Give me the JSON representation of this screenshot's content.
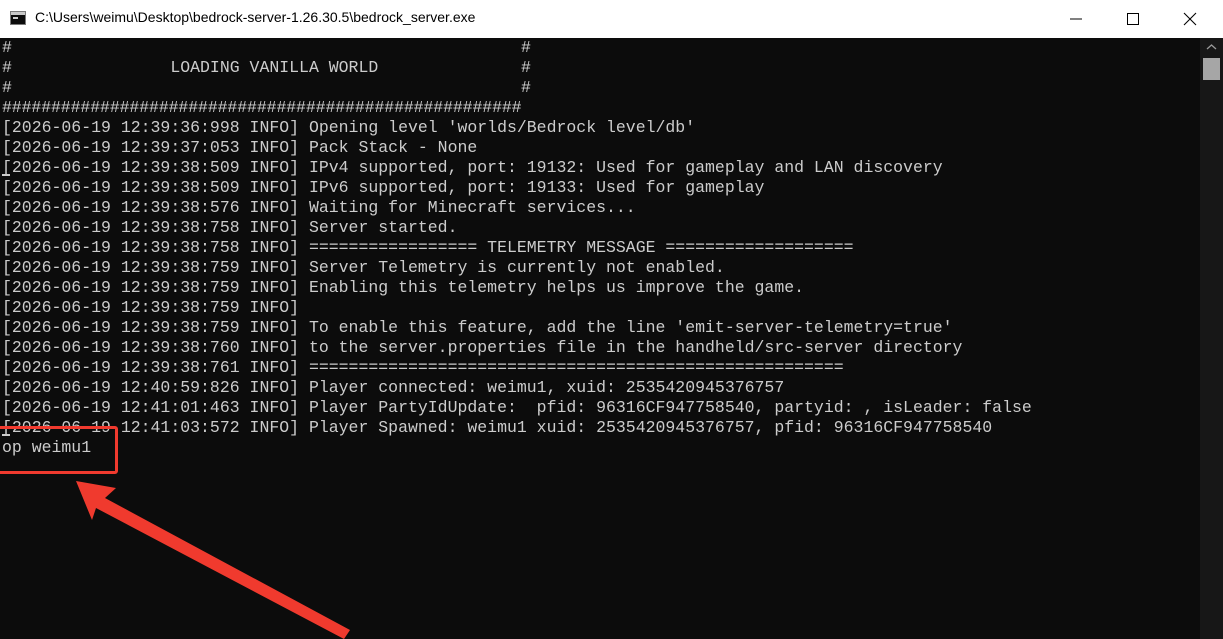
{
  "window": {
    "title": "C:\\Users\\weimu\\Desktop\\bedrock-server-1.26.30.5\\bedrock_server.exe"
  },
  "controls": {
    "minimize": "minimize-icon",
    "maximize": "maximize-icon",
    "close": "close-icon"
  },
  "console": {
    "header_lines": [
      "#",
      "#                LOADING VANILLA WORLD",
      "#",
      "#####################################################"
    ],
    "header_right": [
      "#",
      "#",
      "#"
    ],
    "log_lines": [
      "[2026-06-19 12:39:36:998 INFO] Opening level 'worlds/Bedrock level/db'",
      "[2026-06-19 12:39:37:053 INFO] Pack Stack - None",
      "[2026-06-19 12:39:38:509 INFO] IPv4 supported, port: 19132: Used for gameplay and LAN discovery",
      "[2026-06-19 12:39:38:509 INFO] IPv6 supported, port: 19133: Used for gameplay",
      "[2026-06-19 12:39:38:576 INFO] Waiting for Minecraft services...",
      "[2026-06-19 12:39:38:758 INFO] Server started.",
      "[2026-06-19 12:39:38:758 INFO] ================= TELEMETRY MESSAGE ===================",
      "[2026-06-19 12:39:38:759 INFO] Server Telemetry is currently not enabled.",
      "[2026-06-19 12:39:38:759 INFO] Enabling this telemetry helps us improve the game.",
      "[2026-06-19 12:39:38:759 INFO]",
      "[2026-06-19 12:39:38:759 INFO] To enable this feature, add the line 'emit-server-telemetry=true'",
      "[2026-06-19 12:39:38:760 INFO] to the server.properties file in the handheld/src-server directory",
      "[2026-06-19 12:39:38:761 INFO] ======================================================",
      "[2026-06-19 12:40:59:826 INFO] Player connected: weimu1, xuid: 2535420945376757",
      "[2026-06-19 12:41:01:463 INFO] Player PartyIdUpdate:  pfid: 96316CF947758540, partyid: , isLeader: false",
      "[2026-06-19 12:41:03:572 INFO] Player Spawned: weimu1 xuid: 2535420945376757, pfid: 96316CF947758540"
    ],
    "command_input": "op weimu1"
  },
  "annotation": {
    "color": "#f03a2e"
  },
  "colors": {
    "console_bg": "#0c0c0c",
    "console_text": "#cccccc",
    "titlebar_bg": "#ffffff"
  }
}
